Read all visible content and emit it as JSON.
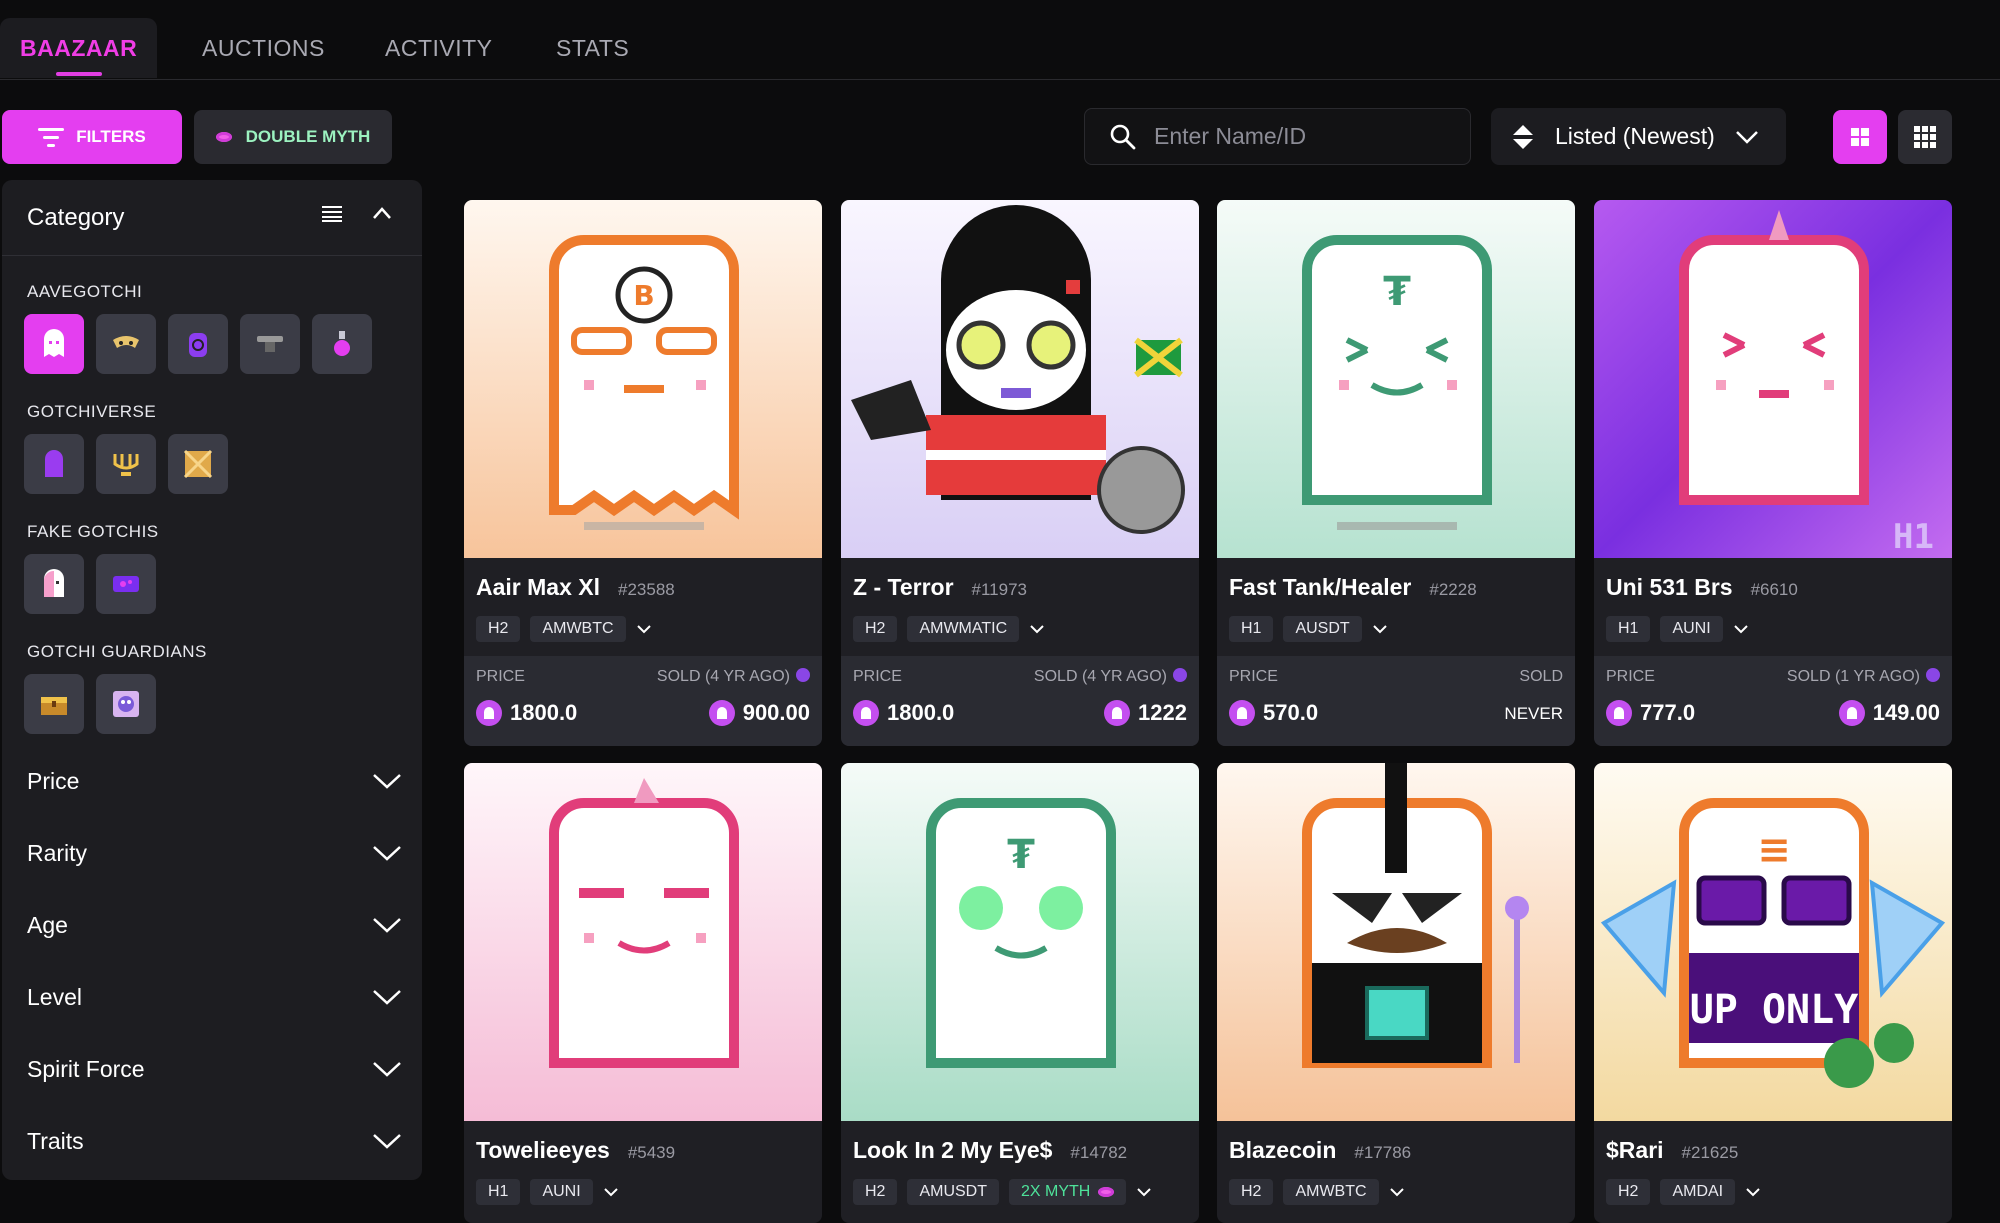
{
  "nav": {
    "tabs": [
      "BAAZAAR",
      "AUCTIONS",
      "ACTIVITY",
      "STATS"
    ],
    "active": "BAAZAAR"
  },
  "toolbar": {
    "filters_label": "FILTERS",
    "double_myth_label": "DOUBLE MYTH",
    "search_placeholder": "Enter Name/ID",
    "sort_label": "Listed (Newest)"
  },
  "sidebar": {
    "title": "Category",
    "sections": {
      "aavegotchi": "AAVEGOTCHI",
      "gotchiverse": "GOTCHIVERSE",
      "fake_gotchis": "FAKE GOTCHIS",
      "gotchi_guardians": "GOTCHI GUARDIANS"
    },
    "filters": [
      "Price",
      "Rarity",
      "Age",
      "Level",
      "Spirit Force",
      "Traits"
    ]
  },
  "cards": [
    {
      "name": "Aair Max Xl",
      "id": "#23588",
      "haunt": "H2",
      "collateral": "AMWBTC",
      "price_label": "PRICE",
      "price": "1800.0",
      "sold_label": "SOLD (4 YR AGO)",
      "sold": "900.00"
    },
    {
      "name": "Z - Terror",
      "id": "#11973",
      "haunt": "H2",
      "collateral": "AMWMATIC",
      "price_label": "PRICE",
      "price": "1800.0",
      "sold_label": "SOLD (4 YR AGO)",
      "sold": "1222"
    },
    {
      "name": "Fast Tank/Healer",
      "id": "#2228",
      "haunt": "H1",
      "collateral": "AUSDT",
      "price_label": "PRICE",
      "price": "570.0",
      "sold_label": "SOLD",
      "sold": "NEVER"
    },
    {
      "name": "Uni 531 Brs",
      "id": "#6610",
      "haunt": "H1",
      "collateral": "AUNI",
      "price_label": "PRICE",
      "price": "777.0",
      "sold_label": "SOLD (1 YR AGO)",
      "sold": "149.00"
    },
    {
      "name": "Towelieeyes",
      "id": "#5439",
      "haunt": "H1",
      "collateral": "AUNI"
    },
    {
      "name": "Look In 2 My Eye$",
      "id": "#14782",
      "haunt": "H2",
      "collateral": "AMUSDT",
      "badge": "2X MYTH"
    },
    {
      "name": "Blazecoin",
      "id": "#17786",
      "haunt": "H2",
      "collateral": "AMWBTC"
    },
    {
      "name": "$Rari",
      "id": "#21625",
      "haunt": "H2",
      "collateral": "AMDAI"
    }
  ],
  "colors": {
    "accent": "#e43ef0",
    "myth": "#4ee29a"
  }
}
